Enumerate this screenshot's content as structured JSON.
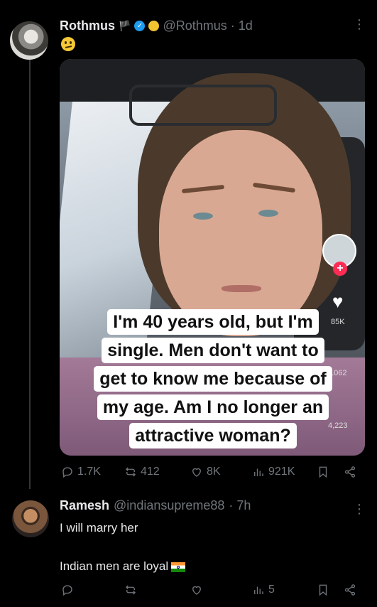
{
  "tweet": {
    "author_name": "Rothmus",
    "flag_icon": "flag-icon",
    "handle": "@Rothmus",
    "time": "· 1d",
    "emoji": "confused-face-emoji",
    "more_label": "⋮",
    "media": {
      "caption_lines": [
        "I'm 40 years old, but I'm",
        "single. Men don't want to",
        "get to know me because of",
        "my age. Am I no longer an",
        "attractive woman?"
      ],
      "overlay_counts": [
        "85K",
        "1062",
        "4,223"
      ]
    },
    "actions": {
      "replies": "1.7K",
      "reposts": "412",
      "likes": "8K",
      "views": "921K"
    }
  },
  "reply": {
    "author_name": "Ramesh",
    "handle": "@indiansupreme88",
    "time": "· 7h",
    "more_label": "⋮",
    "text_line1": "I will marry her",
    "text_line2": "Indian men are loyal",
    "actions": {
      "views": "5"
    }
  },
  "colors": {
    "background": "#000000",
    "text": "#e7e9ea",
    "muted": "#71767b",
    "verified_blue": "#1d9bf0"
  }
}
